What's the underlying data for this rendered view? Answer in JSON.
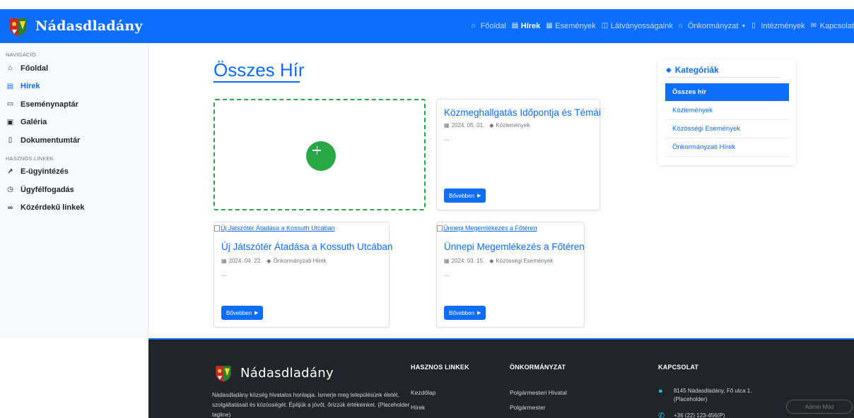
{
  "brand": {
    "name": "Nádasdladány"
  },
  "topnav": [
    {
      "label": "Főoldal",
      "icon": "home-icon",
      "glyph": "⌂"
    },
    {
      "label": "Hírek",
      "icon": "newspaper-icon",
      "glyph": "▤"
    },
    {
      "label": "Események",
      "icon": "calendar-icon",
      "glyph": "▦"
    },
    {
      "label": "Látványosságaink",
      "icon": "landmark-icon",
      "glyph": "◫"
    },
    {
      "label": "Önkormányzat",
      "icon": "building-icon",
      "glyph": "⌂"
    },
    {
      "label": "Intézmények",
      "icon": "institution-icon",
      "glyph": "▯"
    },
    {
      "label": "Kapcsolat",
      "icon": "envelope-icon",
      "glyph": "✉"
    }
  ],
  "sidebar": {
    "nav_heading": "Navigáció",
    "nav_items": [
      {
        "label": "Főoldal",
        "glyph": "⌂"
      },
      {
        "label": "Hírek",
        "glyph": "▤"
      },
      {
        "label": "Eseménynaptár",
        "glyph": "▭"
      },
      {
        "label": "Galéria",
        "glyph": "▣"
      },
      {
        "label": "Dokumentumtár",
        "glyph": "▯"
      }
    ],
    "links_heading": "Hasznos linkek",
    "link_items": [
      {
        "label": "E-ügyintézés",
        "glyph": "↗"
      },
      {
        "label": "Ügyfélfogadás",
        "glyph": "◷"
      },
      {
        "label": "Közérdekű linkek",
        "glyph": "∞"
      }
    ]
  },
  "main": {
    "title": "Összes Hír",
    "more_label": "Bővebben",
    "articles": [
      {
        "title": "Közmeghallgatás Időpontja és Témái",
        "date": "2024. 05. 01.",
        "category": "Közlemények",
        "excerpt": "...",
        "image_alt": ""
      },
      {
        "title": "Új Játszótér Átadása a Kossuth Utcában",
        "date": "2024. 04. 22.",
        "category": "Önkormányzati Hírek",
        "excerpt": "...",
        "image_alt": "Új Játszótér Átadása a Kossuth Utcában"
      },
      {
        "title": "Ünnepi Megemlékezés a Főtéren",
        "date": "2024. 03. 15.",
        "category": "Közösségi Események",
        "excerpt": "...",
        "image_alt": "Ünnepi Megemlékezés a Főtéren"
      }
    ]
  },
  "categories": {
    "title": "Kategóriák",
    "items": [
      "Összes hír",
      "Közlemények",
      "Közösségi Események",
      "Önkormányzati Hírek"
    ]
  },
  "footer": {
    "brand": "Nádasdladány",
    "tagline": "Nádasdladány község hivatalos honlapja. Ismerje meg településünk életét, szolgáltatásait és közösségét. Építjük a jövőt, őrizzük értékeinket. (Placeholder tagline)",
    "links_title": "HASZNOS LINKEK",
    "links": [
      "Kezdőlap",
      "Hírek"
    ],
    "gov_title": "ÖNKORMÁNYZAT",
    "gov_links": [
      "Polgármesteri Hivatal",
      "Polgármester"
    ],
    "contact_title": "KAPCSOLAT",
    "address": "8145 Nádasdladány, Fő utca 1. (Placeholder)",
    "phone": "+36 (22) 123-456(P)"
  },
  "admin_label": "Admin Mód",
  "colors": {
    "primary": "#0d6efd",
    "success": "#28a745",
    "footer": "#212529"
  }
}
